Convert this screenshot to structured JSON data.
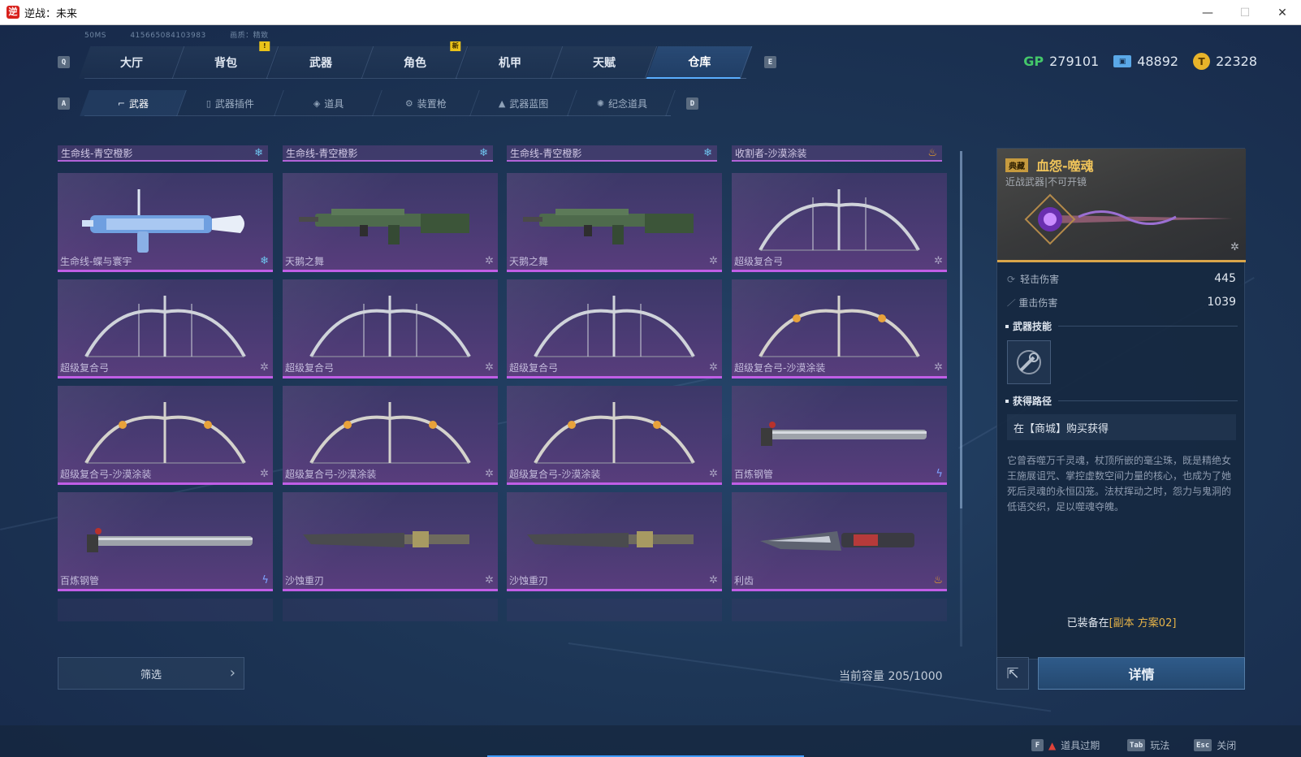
{
  "window": {
    "title": "逆战：未来",
    "controls": [
      "—",
      "☐",
      "✕"
    ]
  },
  "info_line": {
    "ping": "50MS",
    "uid": "415665084103983",
    "quality": "画质：精致"
  },
  "main_nav": {
    "prev_key": "Q",
    "next_key": "E",
    "tabs": [
      {
        "label": "大厅"
      },
      {
        "label": "背包",
        "badge": "!"
      },
      {
        "label": "武器"
      },
      {
        "label": "角色",
        "badge": "新"
      },
      {
        "label": "机甲"
      },
      {
        "label": "天赋"
      },
      {
        "label": "仓库",
        "active": true
      }
    ]
  },
  "currencies": [
    {
      "icon": "gp-icon",
      "label": "GP",
      "value": "279101"
    },
    {
      "icon": "ticket-icon",
      "value": "48892"
    },
    {
      "icon": "coin-icon",
      "value": "22328"
    }
  ],
  "sub_nav": {
    "prev_key": "A",
    "next_key": "D",
    "tabs": [
      {
        "label": "武器",
        "icon": "gun-icon",
        "active": true
      },
      {
        "label": "武器插件",
        "icon": "chip-icon"
      },
      {
        "label": "道具",
        "icon": "item-icon"
      },
      {
        "label": "装置枪",
        "icon": "device-icon"
      },
      {
        "label": "武器蓝图",
        "icon": "blueprint-icon"
      },
      {
        "label": "纪念道具",
        "icon": "memento-icon"
      }
    ]
  },
  "groups": [
    {
      "label": "生命线-青空橙影",
      "tier": "ice"
    },
    {
      "label": "生命线-青空橙影",
      "tier": "ice"
    },
    {
      "label": "生命线-青空橙影",
      "tier": "ice"
    },
    {
      "label": "收割者-沙漠涂装",
      "tier": "fire"
    }
  ],
  "items": [
    {
      "name": "生命线-蝶与寰宇",
      "tier": "ice",
      "art": "rifle-blue"
    },
    {
      "name": "天鹅之舞",
      "tier": "star",
      "art": "rifle-green"
    },
    {
      "name": "天鹅之舞",
      "tier": "star",
      "art": "rifle-green"
    },
    {
      "name": "超级复合弓",
      "tier": "star",
      "art": "bow"
    },
    {
      "name": "超级复合弓",
      "tier": "star",
      "art": "bow"
    },
    {
      "name": "超级复合弓",
      "tier": "star",
      "art": "bow"
    },
    {
      "name": "超级复合弓",
      "tier": "star",
      "art": "bow"
    },
    {
      "name": "超级复合弓-沙漠涂装",
      "tier": "star",
      "art": "bow-gold"
    },
    {
      "name": "超级复合弓-沙漠涂装",
      "tier": "star",
      "art": "bow-gold"
    },
    {
      "name": "超级复合弓-沙漠涂装",
      "tier": "star",
      "art": "bow-gold"
    },
    {
      "name": "超级复合弓-沙漠涂装",
      "tier": "star",
      "art": "bow-gold"
    },
    {
      "name": "百炼钢管",
      "tier": "bolt",
      "art": "pipe"
    },
    {
      "name": "百炼钢管",
      "tier": "bolt",
      "art": "pipe"
    },
    {
      "name": "沙蚀重刃",
      "tier": "star",
      "art": "blade"
    },
    {
      "name": "沙蚀重刃",
      "tier": "star",
      "art": "blade"
    },
    {
      "name": "利齿",
      "tier": "fire",
      "art": "knife"
    }
  ],
  "filter": {
    "label": "筛选"
  },
  "capacity": {
    "label": "当前容量 205/1000"
  },
  "detail": {
    "rarity": "典藏",
    "name": "血怨-噬魂",
    "subtitle": "近战武器|不可开镜",
    "stats": [
      {
        "label": "轻击伤害",
        "value": "445"
      },
      {
        "label": "重击伤害",
        "value": "1039"
      }
    ],
    "skill_title": "武器技能",
    "acquire_title": "获得路径",
    "acquire_text": "在【商城】购买获得",
    "description": "它曾吞噬万千灵魂，杖顶所嵌的毫尘珠，既是精绝女王施展诅咒、掌控虚数空间力量的核心，也成为了她死后灵魂的永恒囚笼。法杖挥动之时，怨力与鬼洞的低语交织，足以噬魂夺魄。",
    "equipped_prefix": "已装备在",
    "equipped_value": "[副本 方案02]",
    "details_button": "详情"
  },
  "hints": [
    {
      "key": "F",
      "label": "道具过期",
      "icon": "warning-icon"
    },
    {
      "key": "Tab",
      "label": "玩法"
    },
    {
      "key": "Esc",
      "label": "关闭"
    }
  ],
  "colors": {
    "accent_blue": "#5aaeff",
    "rarity_purple": "#c05ee6",
    "rarity_gold": "#d8a54a",
    "gp_green": "#44c76a"
  }
}
